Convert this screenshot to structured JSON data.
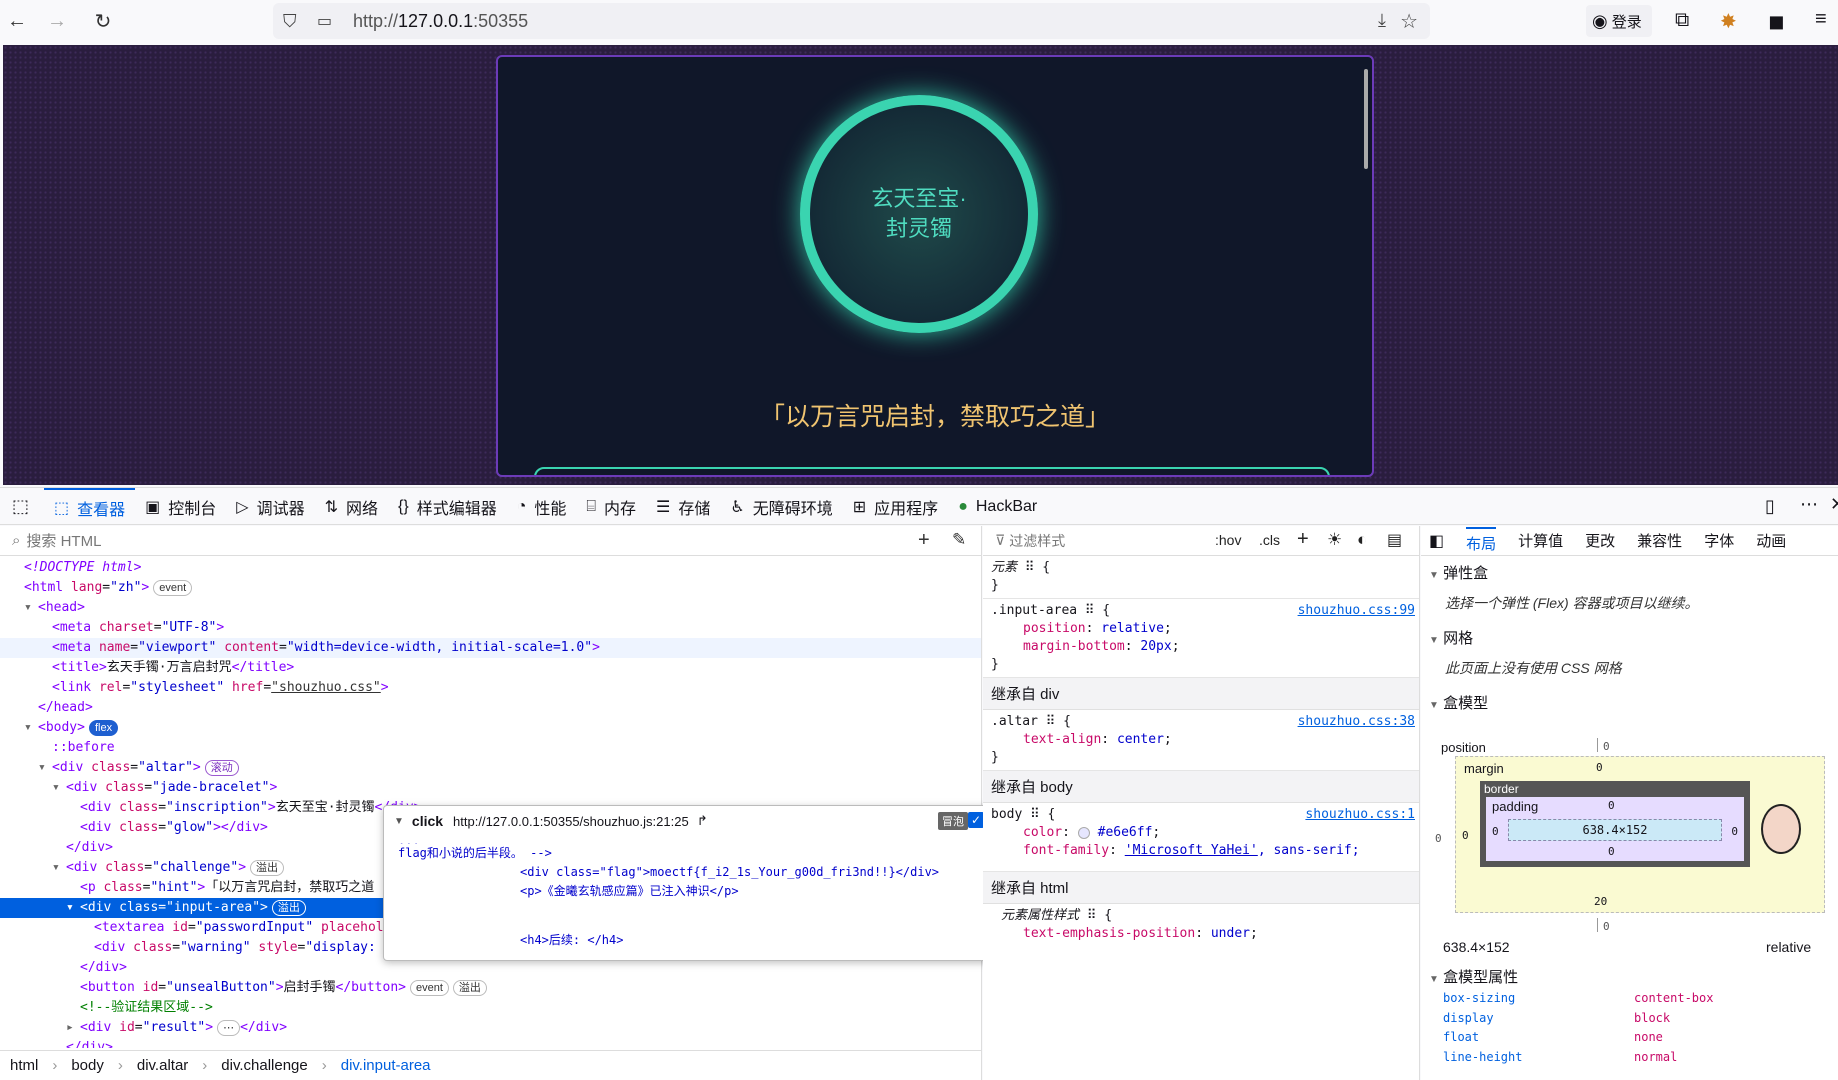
{
  "browser": {
    "url_prefix": "http://",
    "url_host": "127.0.0.1",
    "url_port": ":50355",
    "login_label": "登录"
  },
  "page": {
    "inscription_line1": "玄天至宝·",
    "inscription_line2": "封灵镯",
    "hint": "「以万言咒启封，禁取巧之道」"
  },
  "devtools_tabs": [
    {
      "label": "查看器",
      "icon": "inspector-icon"
    },
    {
      "label": "控制台",
      "icon": "console-icon"
    },
    {
      "label": "调试器",
      "icon": "debugger-icon"
    },
    {
      "label": "网络",
      "icon": "network-icon"
    },
    {
      "label": "样式编辑器",
      "icon": "style-editor-icon"
    },
    {
      "label": "性能",
      "icon": "performance-icon"
    },
    {
      "label": "内存",
      "icon": "memory-icon"
    },
    {
      "label": "存储",
      "icon": "storage-icon"
    },
    {
      "label": "无障碍环境",
      "icon": "accessibility-icon"
    },
    {
      "label": "应用程序",
      "icon": "application-icon"
    },
    {
      "label": "HackBar",
      "icon": "hackbar-icon"
    }
  ],
  "inspector": {
    "search_placeholder": "搜索 HTML",
    "breadcrumb": [
      "html",
      "body",
      "div.altar",
      "div.challenge",
      "div.input-area"
    ]
  },
  "popup": {
    "event": "click",
    "location": "http://127.0.0.1:50355/shouzhuo.js:21:25",
    "bubble_label": "冒泡",
    "line_a": "flag和小说的后半段。 -->",
    "line_b": "<div class=\"flag\">moectf{f_i2_1s_Your_g00d_fri3nd!!}</div>",
    "line_c": "<p>《金曦玄轨感应篇》已注入神识</p>",
    "line_d": "<h4>后续: </h4>"
  },
  "rules": {
    "filter_placeholder": "过滤样式",
    "hov": ":hov",
    "cls": ".cls",
    "element_selector": "元素",
    "r1_selector": ".input-area",
    "r1_link": "shouzhuo.css:99",
    "r1_p1n": "position",
    "r1_p1v": "relative",
    "r1_p2n": "margin-bottom",
    "r1_p2v": "20px",
    "inh_div": "继承自 div",
    "r2_selector": ".altar",
    "r2_link": "shouzhuo.css:38",
    "r2_pn": "text-align",
    "r2_pv": "center",
    "inh_body": "继承自 body",
    "r3_selector": "body",
    "r3_link": "shouzhuo.css:1",
    "r3_p1n": "color",
    "r3_p1v": "#e6e6ff",
    "r3_p2n": "font-family",
    "r3_p2v": "'Microsoft YaHei'",
    "r3_p2v_rest": ", sans-serif;",
    "inh_html": "继承自 html",
    "r4_selector": "元素属性样式",
    "r4_pn": "text-emphasis-position",
    "r4_pv": "under"
  },
  "layout": {
    "tabs": [
      "布局",
      "计算值",
      "更改",
      "兼容性",
      "字体",
      "动画"
    ],
    "flex_title": "弹性盒",
    "flex_note": "选择一个弹性 (Flex) 容器或项目以继续。",
    "grid_title": "网格",
    "grid_note": "此页面上没有使用 CSS 网格",
    "box_title": "盒模型",
    "position_label": "position",
    "margin_label": "margin",
    "border_label": "border",
    "padding_label": "padding",
    "content_size": "638.4×152",
    "zero": "0",
    "margin_bottom": "20",
    "dims": "638.4×152",
    "position_value": "relative",
    "props_title": "盒模型属性",
    "props": [
      {
        "name": "box-sizing",
        "value": "content-box"
      },
      {
        "name": "display",
        "value": "block"
      },
      {
        "name": "float",
        "value": "none"
      },
      {
        "name": "line-height",
        "value": "normal"
      }
    ]
  }
}
